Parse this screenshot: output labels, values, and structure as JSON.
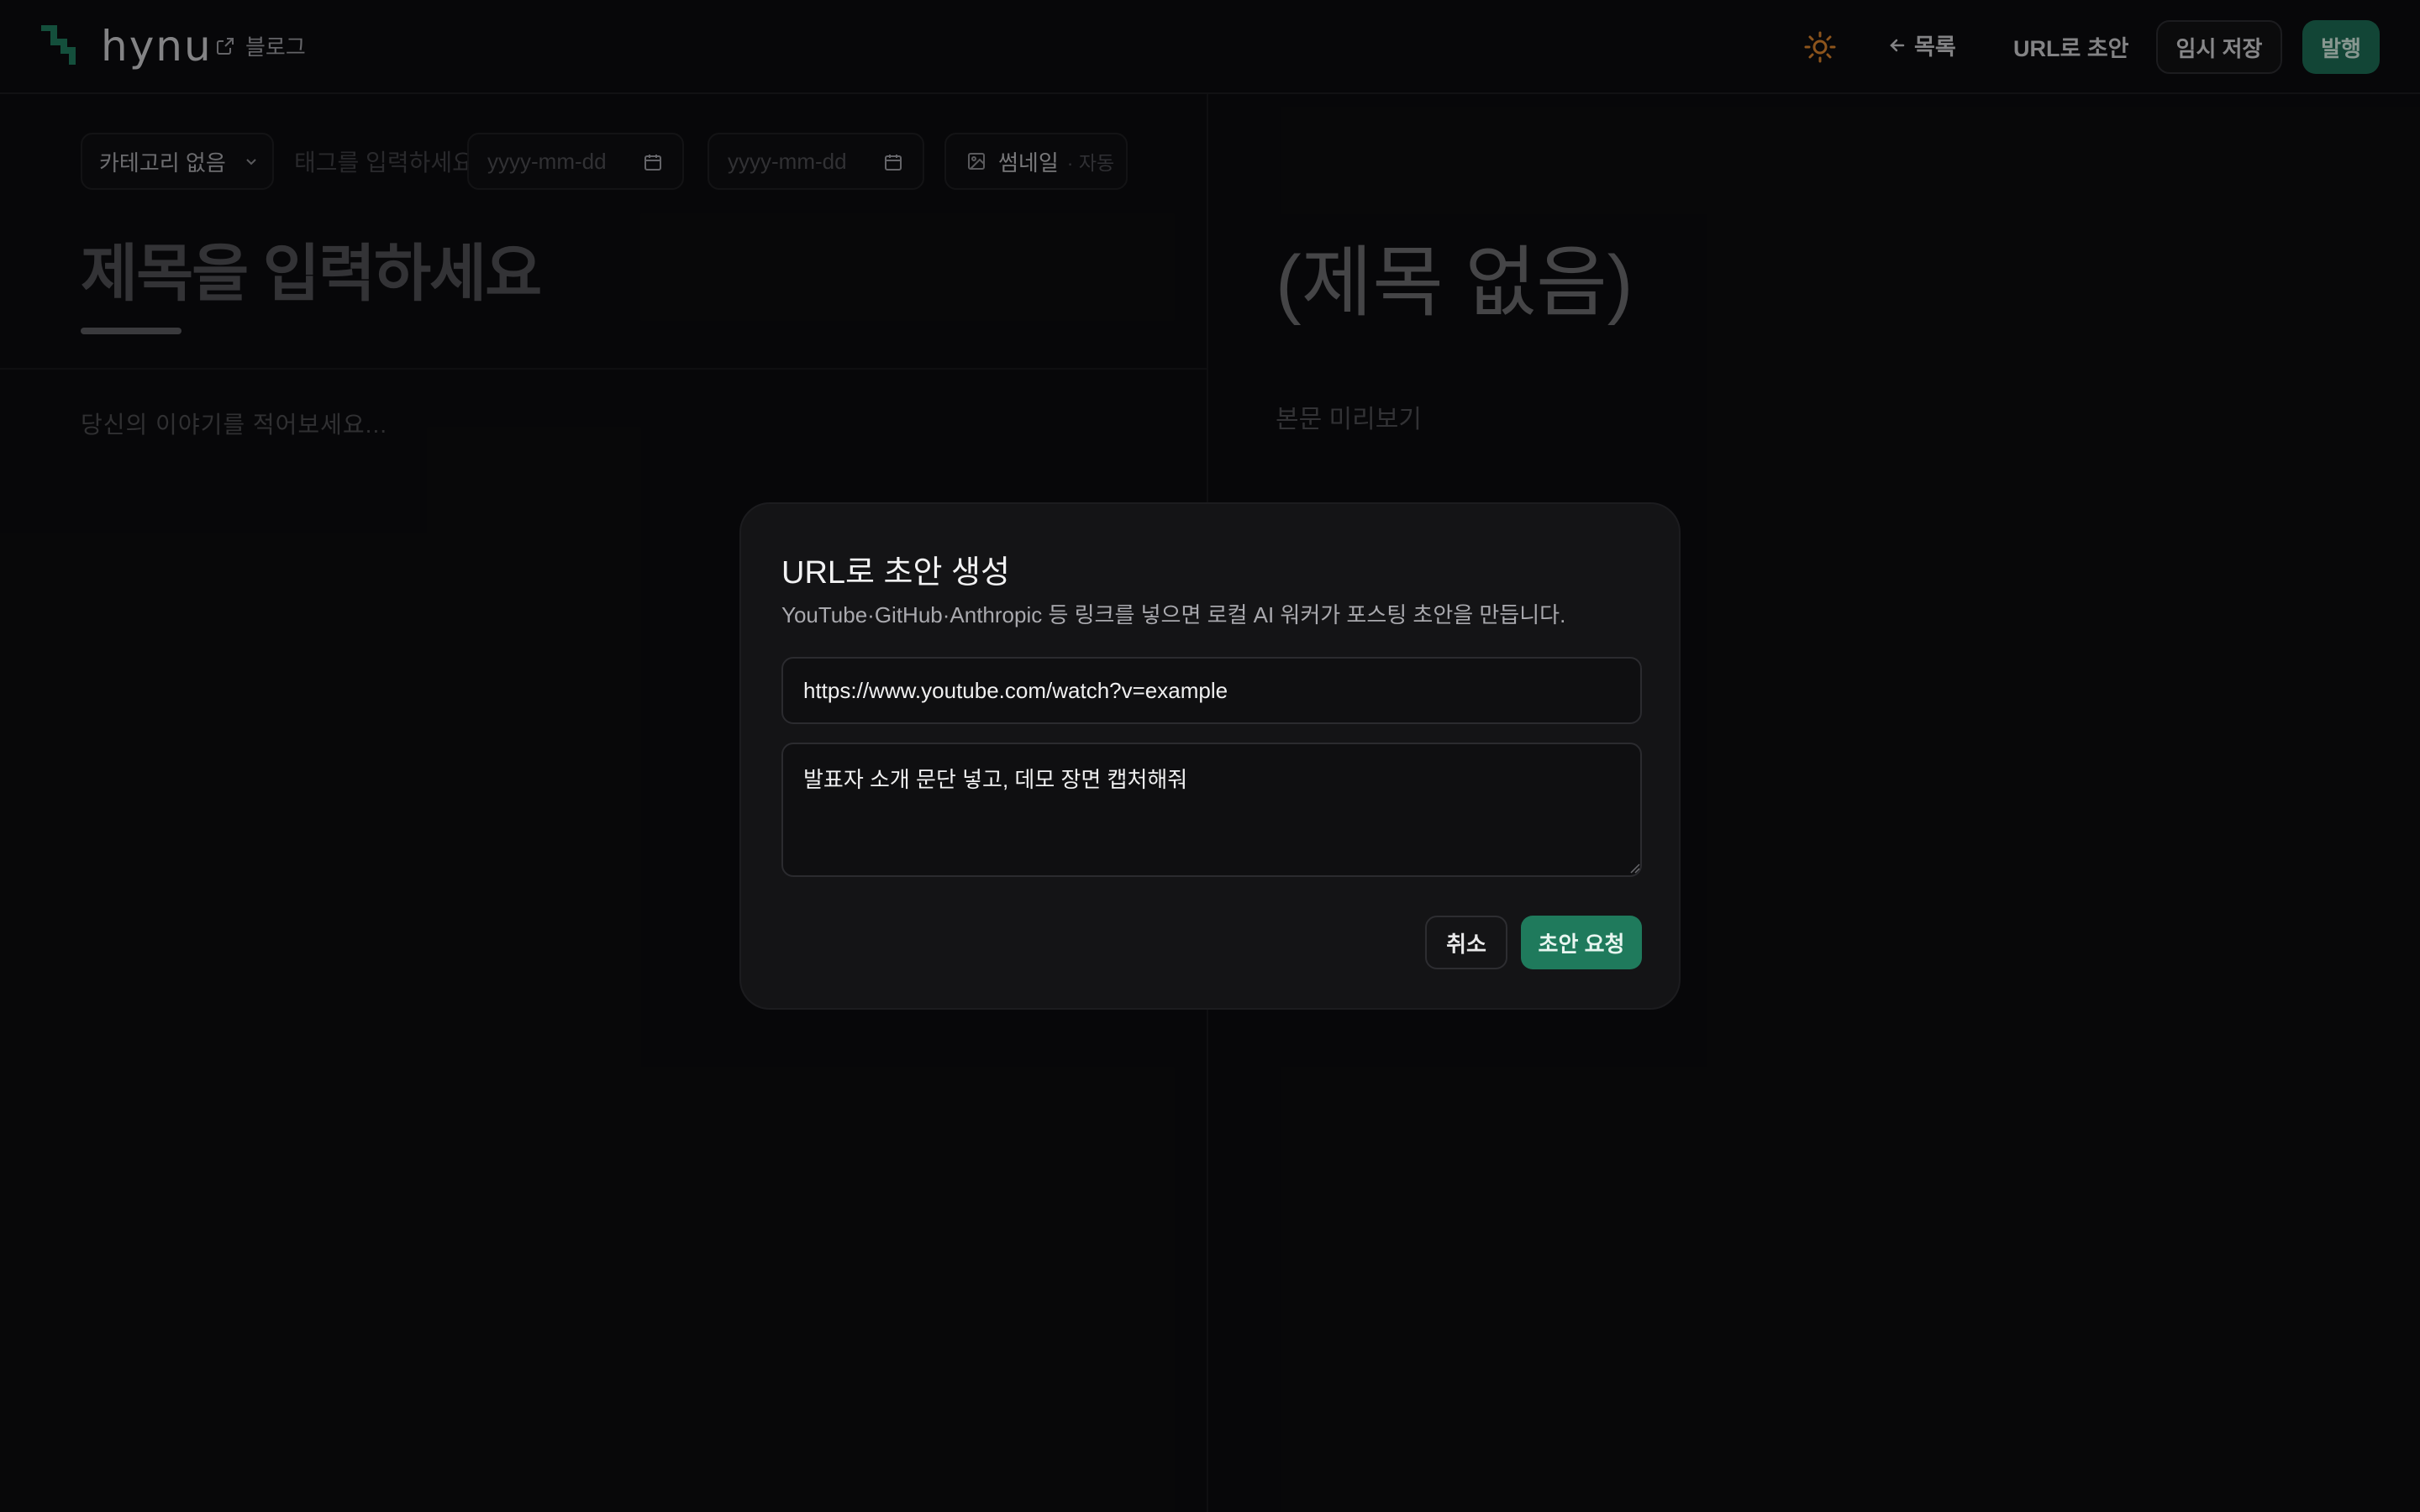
{
  "colors": {
    "background": "#0c0c0e",
    "accent": "#1f7a5c",
    "publish": "#1c6b53",
    "sun": "#d9822b"
  },
  "header": {
    "logo_text": "hynu",
    "blog_link": "블로그",
    "theme_icon": "sun-icon",
    "nav_list": "목록",
    "nav_url_draft": "URL로 초안",
    "save_draft": "임시 저장",
    "publish": "발행"
  },
  "editor": {
    "category": "카테고리 없음",
    "tag_placeholder": "태그를 입력하세요 (쉼표로",
    "date1_placeholder": "yyyy-mm-dd",
    "date2_placeholder": "yyyy-mm-dd",
    "thumbnail_label": "썸네일",
    "thumbnail_auto": "· 자동",
    "title_placeholder": "제목을 입력하세요",
    "body_placeholder": "당신의 이야기를 적어보세요..."
  },
  "preview": {
    "title": "(제목 없음)",
    "body": "본문 미리보기"
  },
  "modal": {
    "title": "URL로 초안 생성",
    "description": "YouTube·GitHub·Anthropic 등 링크를 넣으면 로컬 AI 워커가 포스팅 초안을 만듭니다.",
    "url_value": "https://www.youtube.com/watch?v=example",
    "note_value": "발표자 소개 문단 넣고, 데모 장면 캡처해줘",
    "cancel": "취소",
    "submit": "초안 요청"
  }
}
